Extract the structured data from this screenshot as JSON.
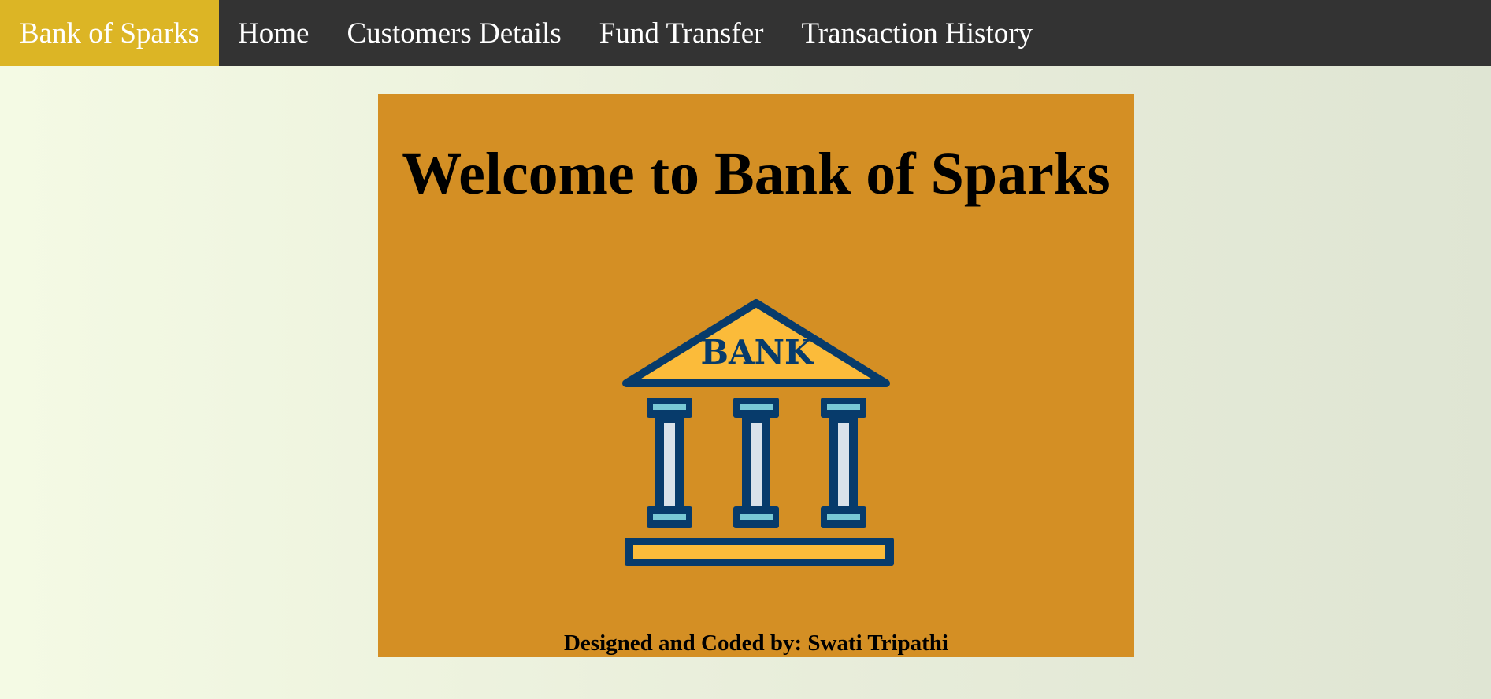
{
  "navbar": {
    "brand": "Bank of Sparks",
    "items": [
      {
        "label": "Home"
      },
      {
        "label": "Customers Details"
      },
      {
        "label": "Fund Transfer"
      },
      {
        "label": "Transaction History"
      }
    ]
  },
  "main": {
    "title": "Welcome to Bank of Sparks",
    "icon_text": "BANK",
    "credit": "Designed and Coded by: Swati Tripathi"
  },
  "colors": {
    "navbar_bg": "#333333",
    "brand_bg": "#dcb525",
    "card_bg": "#d48f24",
    "icon_dark": "#073b6b",
    "icon_yellow": "#fbbb3a",
    "icon_cyan": "#79c9d6"
  }
}
